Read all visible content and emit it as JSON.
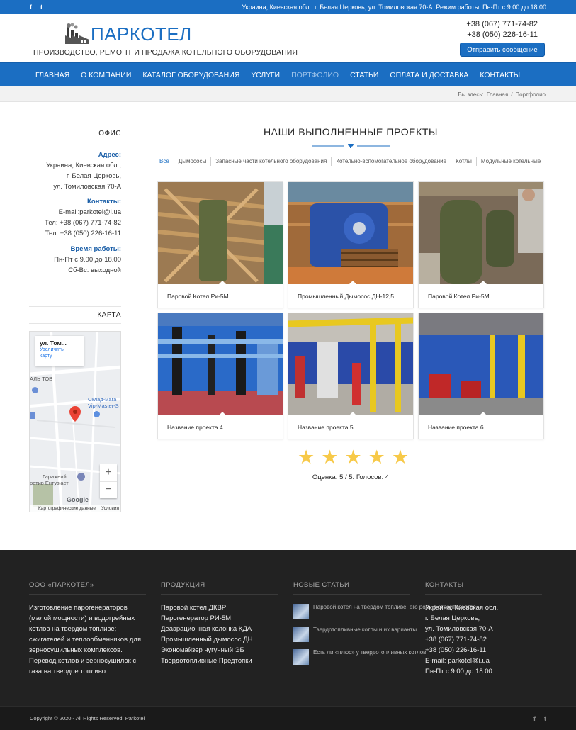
{
  "topbar": {
    "social": [
      "f",
      "t"
    ],
    "info": "Украина, Киевская обл., г. Белая Церковь, ул. Томиловская 70-А. Режим работы: Пн-Пт с 9.00 до 18.00"
  },
  "header": {
    "logo_title": "ПАРКОТЕЛ",
    "logo_subtitle": "ПРОИЗВОДСТВО, РЕМОНТ И ПРОДАЖА КОТЕЛЬНОГО ОБОРУДОВАНИЯ",
    "phone1": "+38 (067) 771-74-82",
    "phone2": "+38 (050) 226-16-11",
    "send_button": "Отправить сообщение"
  },
  "nav": {
    "items": [
      {
        "label": "ГЛАВНАЯ"
      },
      {
        "label": "О КОМПАНИИ"
      },
      {
        "label": "КАТАЛОГ ОБОРУДОВАНИЯ"
      },
      {
        "label": "УСЛУГИ"
      },
      {
        "label": "ПОРТФОЛИО"
      },
      {
        "label": "СТАТЬИ"
      },
      {
        "label": "ОПЛАТА И ДОСТАВКА"
      },
      {
        "label": "КОНТАКТЫ"
      }
    ],
    "active_index": 4
  },
  "breadcrumb": {
    "prefix": "Вы здесь:",
    "home": "Главная",
    "sep": "/",
    "current": "Портфолио"
  },
  "sidebar": {
    "office_title": "ОФИС",
    "address_label": "Адрес:",
    "address_lines": [
      "Украина, Киевская обл.,",
      "г. Белая Церковь,",
      "ул. Томиловская 70-А"
    ],
    "contacts_label": "Контакты:",
    "contact_lines": [
      "E-mail:parkotel@i.ua",
      "Тел: +38 (067) 771-74-82",
      "Тел: +38 (050) 226-16-11"
    ],
    "hours_label": "Время работы:",
    "hours_lines": [
      "Пн-Пт с 9.00 до 18.00",
      "Сб-Вс: выходной"
    ],
    "map_title": "КАРТА",
    "map": {
      "card_title": "ул. Том...",
      "card_link1": "Увеличить",
      "card_link2": "карту",
      "label1": "АЛЬ ТОВ",
      "label2": "Склад-мага",
      "label3": "Vip-Master-S",
      "label4": "Гаражний",
      "label5": "ратив Ентузіаст",
      "zoom_in": "+",
      "zoom_out": "−",
      "google": "Google",
      "footer1": "Картографические данные",
      "footer2": "Условия"
    }
  },
  "main": {
    "title": "НАШИ ВЫПОЛНЕННЫЕ ПРОЕКТЫ",
    "filters": [
      "Все",
      "Дымососы",
      "Запасные части котельного оборудования",
      "Котельно-вспомогательное оборудование",
      "Котлы",
      "Модульные котельные"
    ],
    "projects": [
      {
        "title": "Паровой Котел Ри-5М"
      },
      {
        "title": "Промышленный Дымосос ДН-12,5"
      },
      {
        "title": "Паровой Котел Ри-5М"
      },
      {
        "title": "Название проекта 4"
      },
      {
        "title": "Название проекта 5"
      },
      {
        "title": "Название проекта 6"
      }
    ],
    "rating_value": 5,
    "rating_max": 5,
    "rating_text": "Оценка: 5 / 5. Голосов: 4"
  },
  "footer": {
    "company_title": "ООО «ПАРКОТЕЛ»",
    "company_lines": [
      "Изготовление парогенераторов",
      "(малой мощности) и водогрейных",
      "котлов на твердом топливе;",
      "сжигателей и теплообменников для",
      "зерносушильных комплексов.",
      "Перевод котлов и зерносушилок с",
      "газа на твердое топливо"
    ],
    "products_title": "ПРОДУКЦИЯ",
    "products": [
      "Паровой котел ДКВР",
      "Парогенератор РИ-5М",
      "Деаэрационная колонка КДА",
      "Промышленный дымосос ДН",
      "Экономайзер чугунный ЭБ",
      "Твердотопливные Предтопки"
    ],
    "news_title": "НОВЫЕ СТАТЬИ",
    "news": [
      "Паровой котел на твердом топливе: его роль в строительстве",
      "Твердотопливные котлы и их варианты",
      "Есть ли «плюс» у твердотопливных котлов"
    ],
    "contacts_title": "КОНТАКТЫ",
    "contacts": [
      "Украина, Киевская обл.,",
      "г. Белая Церковь,",
      "ул. Томиловская 70-А",
      "+38 (067) 771-74-82",
      "+38 (050) 226-16-11",
      "E-mail: parkotel@i.ua",
      "Пн-Пт с 9.00 до 18.00"
    ],
    "copyright": "Copyright © 2020 - All Rights Reserved. Parkotel",
    "social": [
      "f",
      "t"
    ]
  },
  "colors": {
    "brand_blue": "#1b6ec2",
    "active_nav": "#9cc3ea",
    "star": "#f7c948",
    "footer_bg": "#222222"
  }
}
